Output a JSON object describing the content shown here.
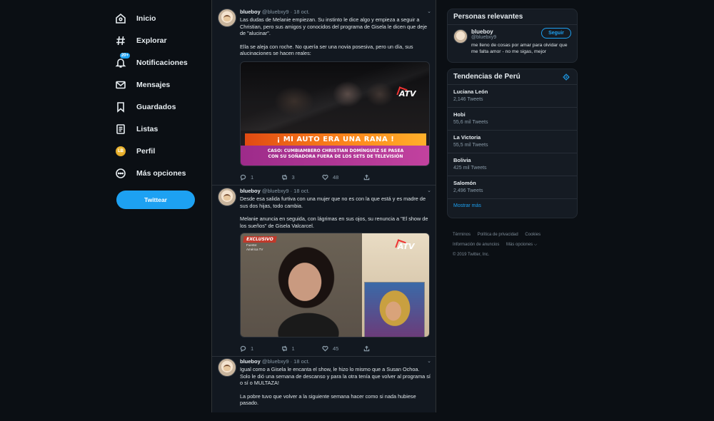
{
  "nav": {
    "items": [
      {
        "label": "Inicio",
        "icon": "home-icon"
      },
      {
        "label": "Explorar",
        "icon": "hashtag-icon"
      },
      {
        "label": "Notificaciones",
        "icon": "bell-icon",
        "badge": "20+"
      },
      {
        "label": "Mensajes",
        "icon": "mail-icon"
      },
      {
        "label": "Guardados",
        "icon": "bookmark-icon"
      },
      {
        "label": "Listas",
        "icon": "list-icon"
      },
      {
        "label": "Perfil",
        "icon": "avatar-icon"
      },
      {
        "label": "Más opciones",
        "icon": "more-icon"
      }
    ],
    "tweet_button": "Twittear"
  },
  "tweets": [
    {
      "name": "blueboy",
      "handle": "@bluebxy9",
      "date": "· 18 oct.",
      "paragraphs": [
        "Las dudas de Melanie empiezan. Su instinto le dice algo y empieza a seguir a Christian, pero sus amigos y conocidos del programa de Gisela le dicen que deje de \"alucinar\".",
        "Ella se aleja con roche. No quería ser una novia posesiva, pero un día, sus alucinaciones se hacen reales:"
      ],
      "media": {
        "banner": "¡ MI AUTO ERA UNA RANA !",
        "caption_line1": "CASO: CUMBIAMBERO CHRISTIAN DOMÍNGUEZ SE PASEA",
        "caption_line2": "CON SU SOÑADORA FUERA DE LOS SETS DE TELEVISIÓN",
        "logo": "ATV"
      },
      "replies": "1",
      "retweets": "3",
      "likes": "48"
    },
    {
      "name": "blueboy",
      "handle": "@bluebxy9",
      "date": "· 18 oct.",
      "paragraphs": [
        "Desde esa salida furtiva con una mujer que no es con la que está y es madre de sus dos hijas, todo cambia.",
        "Melanie anuncia en seguida, con lágrimas en sus ojos, su renuncia a \"El show de los sueños\" de Gisela Valcarcel."
      ],
      "media": {
        "exclusive": "EXCLUSIVO",
        "exclusive_sub1": "Fuente:",
        "exclusive_sub2": "América TV",
        "logo": "ATV"
      },
      "replies": "1",
      "retweets": "1",
      "likes": "45"
    },
    {
      "name": "blueboy",
      "handle": "@bluebxy9",
      "date": "· 18 oct.",
      "paragraphs": [
        "Igual como a Gisela le encanta el show, le hizo lo mismo que a Susan Ochoa. Solo le dió una semana de descanso y para la otra tenía que volver al programa sí o sí o MULTAZA!",
        "La pobre tuvo que volver a la siguiente semana hacer como si nada hubiese pasado."
      ]
    }
  ],
  "relevant": {
    "title": "Personas relevantes",
    "name": "blueboy",
    "handle": "@bluebxy9",
    "follow_label": "Seguir",
    "bio": "me lleno de cosas por amar para olvidar que me falta amor - no me sigas, mejor"
  },
  "trends": {
    "title": "Tendencias de Perú",
    "items": [
      {
        "name": "Luciana León",
        "count": "2,146 Tweets"
      },
      {
        "name": "Hobi",
        "count": "55,6 mil Tweets"
      },
      {
        "name": "La Victoria",
        "count": "55,5 mil Tweets"
      },
      {
        "name": "Bolivia",
        "count": "425 mil Tweets"
      },
      {
        "name": "Salomón",
        "count": "2,496 Tweets"
      }
    ],
    "more_label": "Mostrar más"
  },
  "footer": {
    "terms": "Términos",
    "privacy": "Política de privacidad",
    "cookies": "Cookies",
    "ads": "Información de anuncios",
    "more": "Más opciones ⌵",
    "copyright": "© 2019 Twitter, Inc."
  },
  "colors": {
    "accent": "#1da1f2",
    "background": "#0b0f14",
    "panel": "#151b23"
  }
}
